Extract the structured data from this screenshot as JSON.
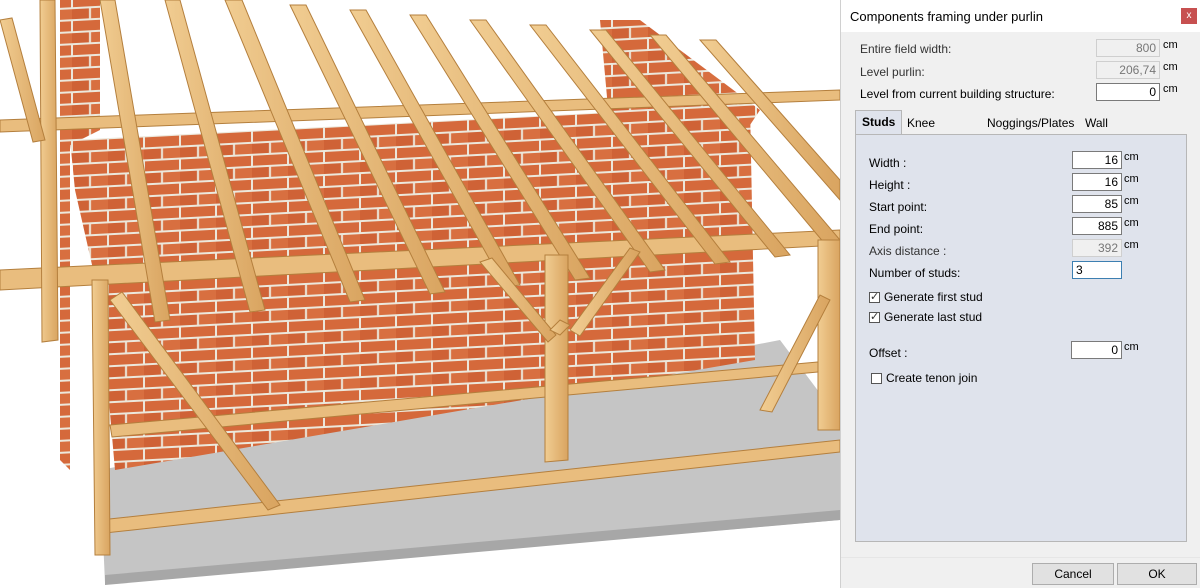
{
  "dialog": {
    "title": "Components framing under purlin",
    "close_label": "x",
    "entire_field_width": {
      "label": "Entire field width:",
      "value": "800",
      "unit": "cm"
    },
    "level_purlin": {
      "label": "Level purlin:",
      "value": "206,74",
      "unit": "cm"
    },
    "level_building": {
      "label": "Level from current building structure:",
      "value": "0",
      "unit": "cm"
    },
    "tabs": [
      {
        "label": "Studs",
        "active": true
      },
      {
        "label": "Knee braces",
        "active": false
      },
      {
        "label": "Noggings/Plates",
        "active": false
      },
      {
        "label": "Wall bracing:",
        "active": false
      }
    ],
    "studs": {
      "width": {
        "label": "Width :",
        "value": "16",
        "unit": "cm"
      },
      "height": {
        "label": "Height :",
        "value": "16",
        "unit": "cm"
      },
      "start_point": {
        "label": "Start point:",
        "value": "85",
        "unit": "cm"
      },
      "end_point": {
        "label": "End point:",
        "value": "885",
        "unit": "cm"
      },
      "axis_distance": {
        "label": "Axis distance :",
        "value": "392",
        "unit": "cm"
      },
      "number_of_studs": {
        "label": "Number of studs:",
        "value": "3"
      },
      "generate_first": {
        "label": "Generate first stud",
        "checked": true
      },
      "generate_last": {
        "label": "Generate last stud",
        "checked": true
      },
      "offset": {
        "label": "Offset :",
        "value": "0",
        "unit": "cm"
      },
      "tenon": {
        "label": "Create tenon join",
        "checked": false
      }
    },
    "buttons": {
      "cancel": "Cancel",
      "ok": "OK"
    }
  },
  "viewport": {
    "icon": "3d-roof-framing-model",
    "colors": {
      "timber": "#e9bd7e",
      "timber_edge": "#b47f3d",
      "brick": "#d5693b",
      "mortar": "#ece8dc",
      "floor": "#c5c5c5"
    }
  }
}
